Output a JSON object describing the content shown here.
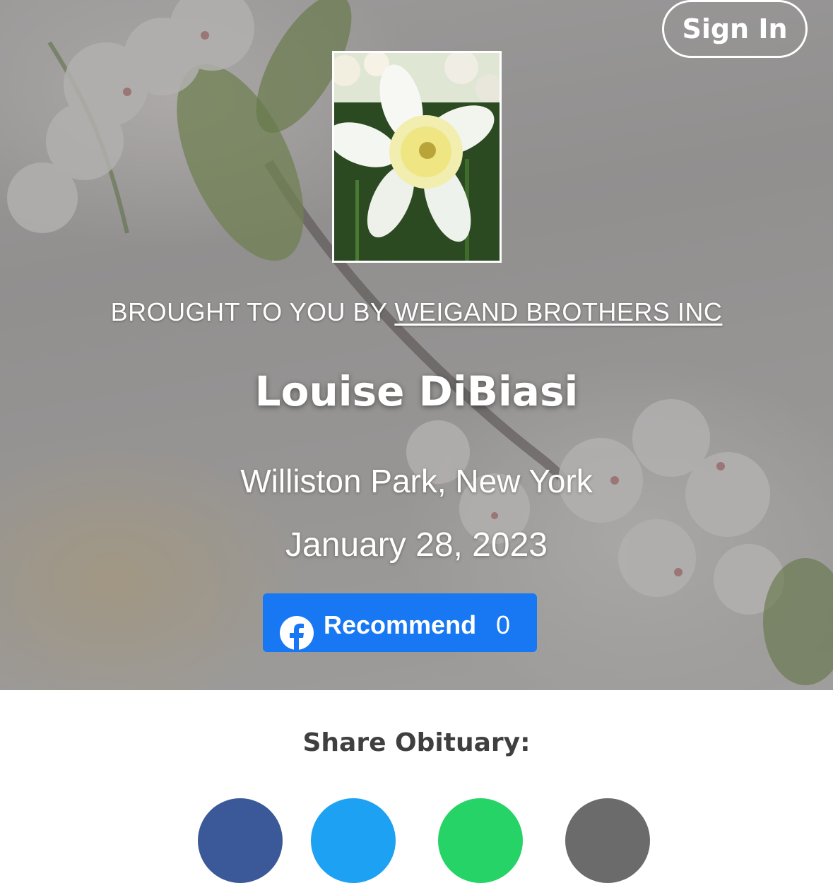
{
  "header": {
    "signin_label": "Sign In"
  },
  "hero": {
    "photo_alt": "White daffodil",
    "brought_prefix": "BROUGHT TO YOU BY ",
    "funeral_home": "WEIGAND BROTHERS INC",
    "name": "Louise DiBiasi",
    "location": "Williston Park, New York",
    "date": "January 28, 2023"
  },
  "recommend": {
    "label": "Recommend",
    "count": "0",
    "icon": "facebook-icon",
    "color": "#1877f2"
  },
  "share": {
    "label": "Share Obituary:",
    "buttons": [
      {
        "icon": "facebook-icon",
        "color": "#3b5998"
      },
      {
        "icon": "twitter-icon",
        "color": "#1da1f2"
      },
      {
        "icon": "whatsapp-icon",
        "color": "#25d366"
      },
      {
        "icon": "email-icon",
        "color": "#6b6b6b"
      }
    ]
  }
}
